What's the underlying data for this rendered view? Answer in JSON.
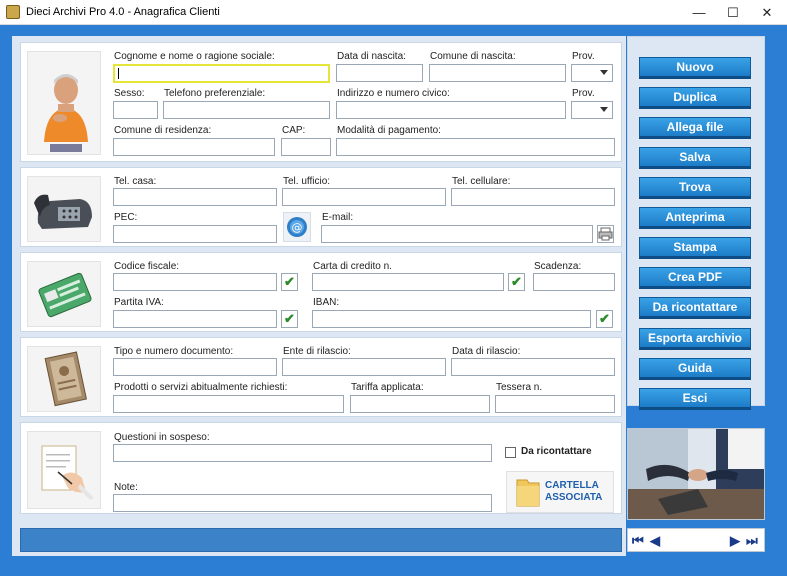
{
  "window": {
    "title": "Dieci Archivi Pro 4.0 - Anagrafica Clienti",
    "minimize": "—",
    "maximize": "☐",
    "close": "✕"
  },
  "section1": {
    "cognome_label": "Cognome e nome o ragione sociale:",
    "data_nascita_label": "Data di nascita:",
    "comune_nascita_label": "Comune di nascita:",
    "prov1_label": "Prov.",
    "sesso_label": "Sesso:",
    "telefono_label": "Telefono preferenziale:",
    "indirizzo_label": "Indirizzo e numero civico:",
    "prov2_label": "Prov.",
    "comune_residenza_label": "Comune di residenza:",
    "cap_label": "CAP:",
    "pagamento_label": "Modalità di pagamento:"
  },
  "section2": {
    "tel_casa_label": "Tel. casa:",
    "tel_ufficio_label": "Tel. ufficio:",
    "tel_cellulare_label": "Tel. cellulare:",
    "pec_label": "PEC:",
    "email_label": "E-mail:"
  },
  "section3": {
    "codice_fiscale_label": "Codice fiscale:",
    "carta_credito_label": "Carta di credito n.",
    "scadenza_label": "Scadenza:",
    "partita_iva_label": "Partita IVA:",
    "iban_label": "IBAN:",
    "check_glyph": "✔"
  },
  "section4": {
    "documento_label": "Tipo e numero documento:",
    "ente_label": "Ente di rilascio:",
    "data_rilascio_label": "Data di rilascio:",
    "prodotti_label": "Prodotti o servizi abitualmente richiesti:",
    "tariffa_label": "Tariffa applicata:",
    "tessera_label": "Tessera n."
  },
  "section5": {
    "questioni_label": "Questioni in sospeso:",
    "ricontattare_label": "Da ricontattare",
    "note_label": "Note:",
    "cartella_line1": "CARTELLA",
    "cartella_line2": "ASSOCIATA"
  },
  "sidebar": {
    "buttons": [
      "Nuovo",
      "Duplica",
      "Allega file",
      "Salva",
      "Trova",
      "Anteprima",
      "Stampa",
      "Crea PDF",
      "Da ricontattare",
      "Esporta archivio",
      "Guida",
      "Esci"
    ]
  },
  "navigation": {
    "first": "⏮",
    "prev": "◀",
    "next": "▶",
    "last": "⏭"
  },
  "colors": {
    "accent": "#2b7ed3",
    "button": "#1d7cc8",
    "focus": "#e5e53a",
    "check": "#2b8a2b"
  }
}
